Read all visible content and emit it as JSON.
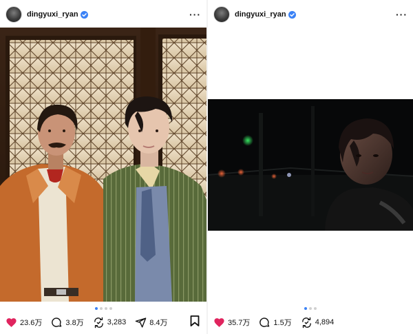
{
  "posts": [
    {
      "username": "dingyuxi_ryan",
      "stats": {
        "likes": "23.6万",
        "comments": "3.8万",
        "reposts": "3,283",
        "shares": "8.4万"
      },
      "carousel": {
        "count": 4,
        "active": 0
      },
      "image_alt": "Two men posing in front of a leaded-glass window"
    },
    {
      "username": "dingyuxi_ryan",
      "stats": {
        "likes": "35.7万",
        "comments": "1.5万",
        "reposts": "4,894"
      },
      "carousel": {
        "count": 3,
        "active": 0
      },
      "image_alt": "Blurry night portrait"
    }
  ],
  "colors": {
    "like": "#e0245e",
    "verified": "#3b82f6",
    "carousel_active": "#3b82f6"
  },
  "icons": [
    "verified-badge-icon",
    "more-icon",
    "heart-icon",
    "comment-icon",
    "repost-icon",
    "share-icon",
    "bookmark-icon"
  ]
}
